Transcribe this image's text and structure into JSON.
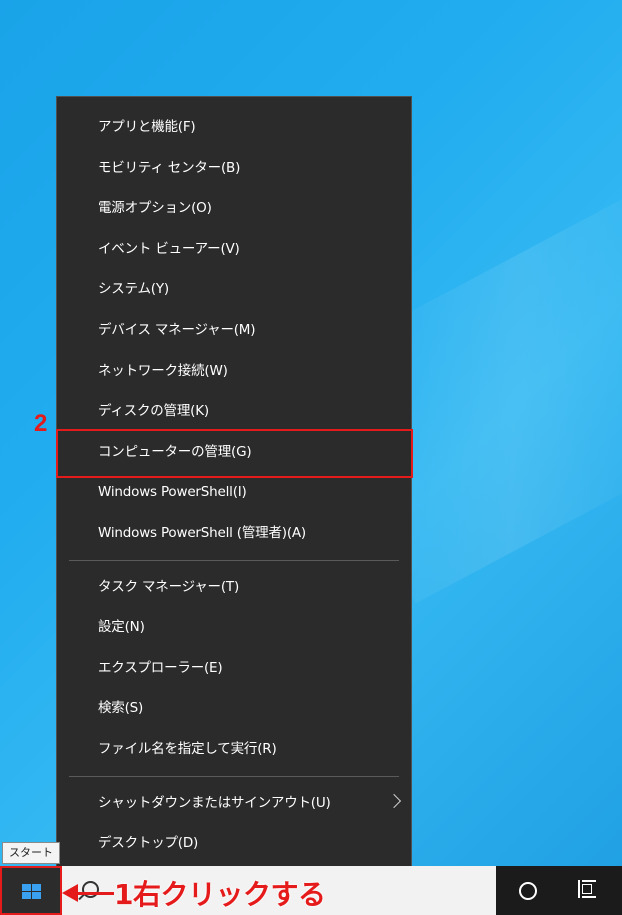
{
  "menu": {
    "items": [
      {
        "label": "アプリと機能(F)"
      },
      {
        "label": "モビリティ センター(B)"
      },
      {
        "label": "電源オプション(O)"
      },
      {
        "label": "イベント ビューアー(V)"
      },
      {
        "label": "システム(Y)"
      },
      {
        "label": "デバイス マネージャー(M)"
      },
      {
        "label": "ネットワーク接続(W)"
      },
      {
        "label": "ディスクの管理(K)"
      },
      {
        "label": "コンピューターの管理(G)"
      },
      {
        "label": "Windows PowerShell(I)"
      },
      {
        "label": "Windows PowerShell (管理者)(A)"
      }
    ],
    "items2": [
      {
        "label": "タスク マネージャー(T)"
      },
      {
        "label": "設定(N)"
      },
      {
        "label": "エクスプローラー(E)"
      },
      {
        "label": "検索(S)"
      },
      {
        "label": "ファイル名を指定して実行(R)"
      }
    ],
    "items3": [
      {
        "label": "シャットダウンまたはサインアウト(U)"
      },
      {
        "label": "デスクトップ(D)"
      }
    ]
  },
  "tooltip": "スタート",
  "annotations": {
    "step2": "2",
    "step1": "1右クリックする",
    "highlight_color": "#e51b1b"
  },
  "taskbar": {
    "start_icon": "windows-logo-icon",
    "search_icon": "search-icon",
    "cortana_icon": "circle-icon",
    "taskview_icon": "task-view-icon"
  }
}
